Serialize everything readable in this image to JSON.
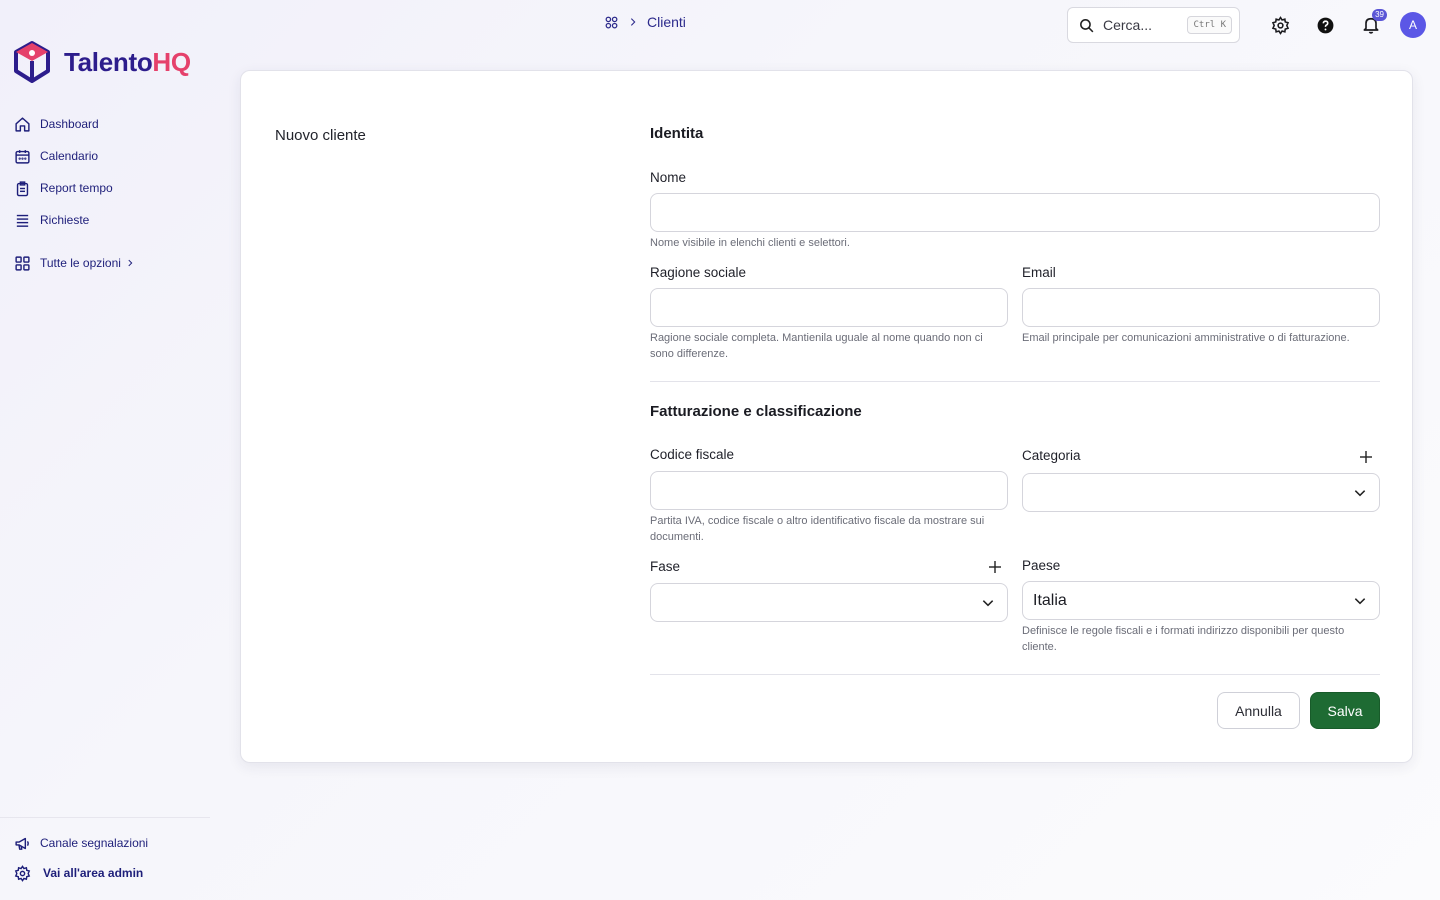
{
  "app": {
    "logo_part1": "Talento",
    "logo_part2": "HQ",
    "brand_colors": {
      "primary": "#2d1d8c",
      "accent": "#e5416b"
    }
  },
  "sidebar": {
    "items": [
      {
        "label": "Dashboard",
        "icon": "home-icon"
      },
      {
        "label": "Calendario",
        "icon": "calendar-icon"
      },
      {
        "label": "Report tempo",
        "icon": "report-icon"
      },
      {
        "label": "Richieste",
        "icon": "list-icon"
      }
    ],
    "more_label": "Tutte le opzioni",
    "bottom": [
      {
        "label": "Canale segnalazioni",
        "icon": "megaphone-icon"
      },
      {
        "label": "Vai all'area admin",
        "icon": "gear-icon"
      }
    ]
  },
  "header": {
    "breadcrumb": [
      "Clienti"
    ],
    "search_placeholder": "Cerca...",
    "search_shortcut": "Ctrl K",
    "notification_count": "39",
    "avatar_initial": "A"
  },
  "page": {
    "title": "Nuovo cliente",
    "section1": {
      "title": "Identita",
      "nome_label": "Nome",
      "nome_value": "",
      "nome_help": "Nome visibile in elenchi clienti e selettori.",
      "ragione_label": "Ragione sociale",
      "ragione_value": "",
      "ragione_help": "Ragione sociale completa. Mantienila uguale al nome quando non ci sono differenze.",
      "email_label": "Email",
      "email_value": "",
      "email_help": "Email principale per comunicazioni amministrative o di fatturazione."
    },
    "section2": {
      "title": "Fatturazione e classificazione",
      "codice_label": "Codice fiscale",
      "codice_value": "",
      "codice_help": "Partita IVA, codice fiscale o altro identificativo fiscale da mostrare sui documenti.",
      "categoria_label": "Categoria",
      "categoria_value": "",
      "fase_label": "Fase",
      "fase_value": "",
      "paese_label": "Paese",
      "paese_value": "Italia",
      "paese_help": "Definisce le regole fiscali e i formati indirizzo disponibili per questo cliente."
    },
    "actions": {
      "cancel": "Annulla",
      "save": "Salva"
    }
  }
}
